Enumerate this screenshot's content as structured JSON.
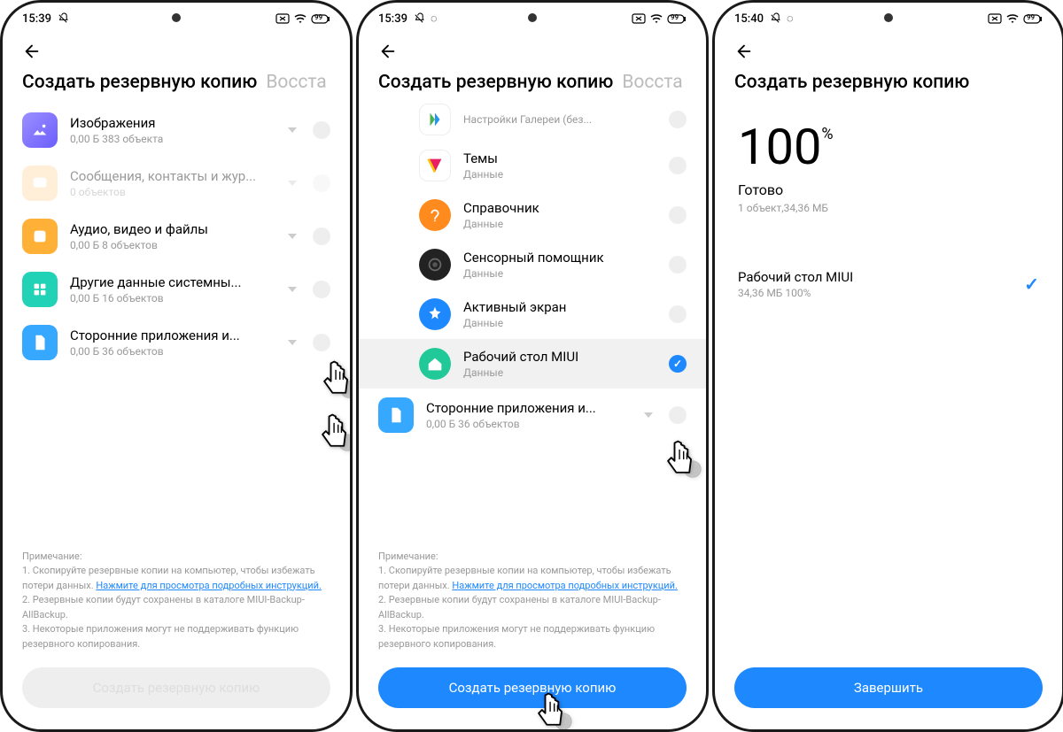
{
  "statusbar": {
    "time1": "15:39",
    "time2": "15:39",
    "time3": "15:40",
    "battery": "99"
  },
  "tabs": {
    "backup": "Создать резервную копию",
    "restore": "Восста"
  },
  "p1": {
    "items": [
      {
        "title": "Изображения",
        "sub": "0,00 Б  383 объекта",
        "color": "#8c7ff0"
      },
      {
        "title": "Сообщения, контакты и жур...",
        "sub": "0 объектов",
        "color": "#ffd9a0",
        "disabled": true
      },
      {
        "title": "Аудио, видео и файлы",
        "sub": "0,00 Б  8 объектов",
        "color": "#ffb137"
      },
      {
        "title": "Другие данные системны...",
        "sub": "0,00 Б  16 объектов",
        "color": "#22d2b6"
      },
      {
        "title": "Сторонние приложения и...",
        "sub": "0,00 Б  36 объектов",
        "color": "#37a8ff"
      }
    ]
  },
  "p2": {
    "top_title": "Настройки Галереи (без...",
    "items": [
      {
        "title": "Темы",
        "sub": "Данные",
        "color": "#fff"
      },
      {
        "title": "Справочник",
        "sub": "Данные",
        "color": "#ff8a1e"
      },
      {
        "title": "Сенсорный помощник",
        "sub": "Данные",
        "color": "#222"
      },
      {
        "title": "Активный экран",
        "sub": "Данные",
        "color": "#1e88ff"
      },
      {
        "title": "Рабочий стол MIUI",
        "sub": "Данные",
        "color": "#20c997",
        "checked": true,
        "hl": true
      }
    ],
    "footer": {
      "title": "Сторонние приложения и...",
      "sub": "0,00 Б  36 объектов",
      "color": "#37a8ff"
    }
  },
  "p3": {
    "progress": "100",
    "pct": "%",
    "status": "Готово",
    "size": "1 объект,34,36 МБ",
    "result_title": "Рабочий стол MIUI",
    "result_sub": "34,36 МБ 100%"
  },
  "notes": {
    "heading": "Примечание:",
    "l1a": "1. Скопируйте резервные копии на компьютер, чтобы избежать потери данных. ",
    "l1link": "Нажмите для просмотра подробных инструкций.",
    "l2": "2. Резервные копии будут сохранены в каталоге MIUI-Backup-AllBackup.",
    "l3": "3. Некоторые приложения могут не поддерживать функцию резервного копирования."
  },
  "btn": {
    "create": "Создать резервную копию",
    "finish": "Завершить"
  }
}
